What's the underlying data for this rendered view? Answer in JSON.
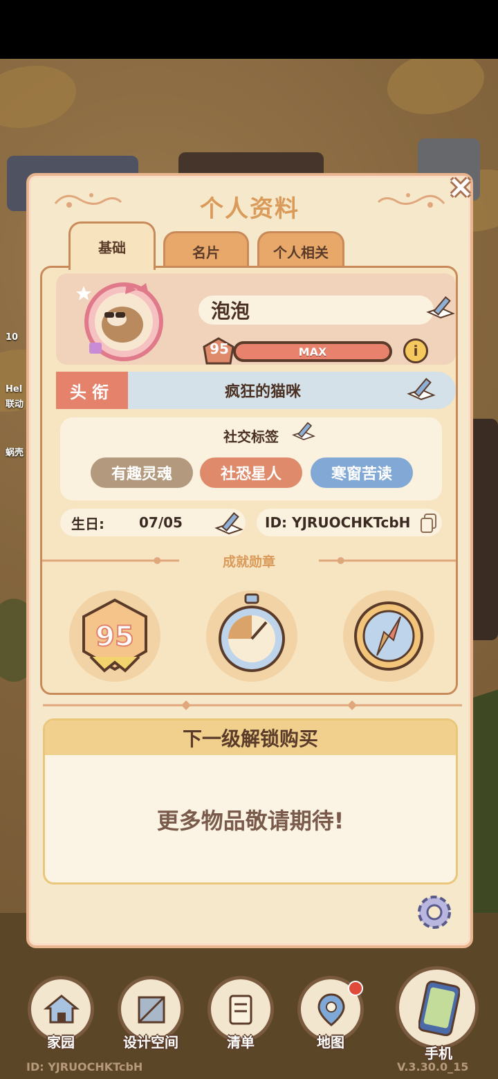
{
  "dialog": {
    "title": "个人资料",
    "tabs": [
      {
        "label": "基础",
        "active": true
      },
      {
        "label": "名片",
        "active": false
      },
      {
        "label": "个人相关",
        "active": false
      }
    ]
  },
  "profile": {
    "name": "泡泡",
    "level": "95",
    "level_bar_label": "MAX",
    "level_progress": 1.0
  },
  "title_row": {
    "label": "头衔",
    "value": "疯狂的猫咪"
  },
  "social_tags": {
    "title": "社交标签",
    "tags": [
      {
        "label": "有趣灵魂",
        "color": "#b39a7e"
      },
      {
        "label": "社恐星人",
        "color": "#e08a6c"
      },
      {
        "label": "寒窗苦读",
        "color": "#82a8d6"
      }
    ]
  },
  "birthday": {
    "label": "生日:",
    "value": "07/05"
  },
  "user_id": {
    "label": "ID: YJRUOCHKTcbH"
  },
  "achievements": {
    "title": "成就勋章",
    "medals": [
      {
        "name": "level-medal",
        "value": "95"
      },
      {
        "name": "stopwatch-medal"
      },
      {
        "name": "compass-medal"
      }
    ]
  },
  "unlock": {
    "header": "下一级解锁购买",
    "body": "更多物品敬请期待!"
  },
  "hud_left": [
    "10",
    "Hel",
    "联动",
    "蜗壳"
  ],
  "bottom_nav": [
    {
      "label": "家园"
    },
    {
      "label": "设计空间"
    },
    {
      "label": "清单"
    },
    {
      "label": "地图"
    },
    {
      "label": "手机"
    }
  ],
  "footer": {
    "id_text": "ID:  YJRUOCHKTcbH",
    "version": "V.3.30.0_15"
  },
  "colors": {
    "accent": "#d99a5a",
    "title_bg": "#e4826c",
    "level_fill": "#e9826c",
    "notification": "#e04a3a"
  }
}
